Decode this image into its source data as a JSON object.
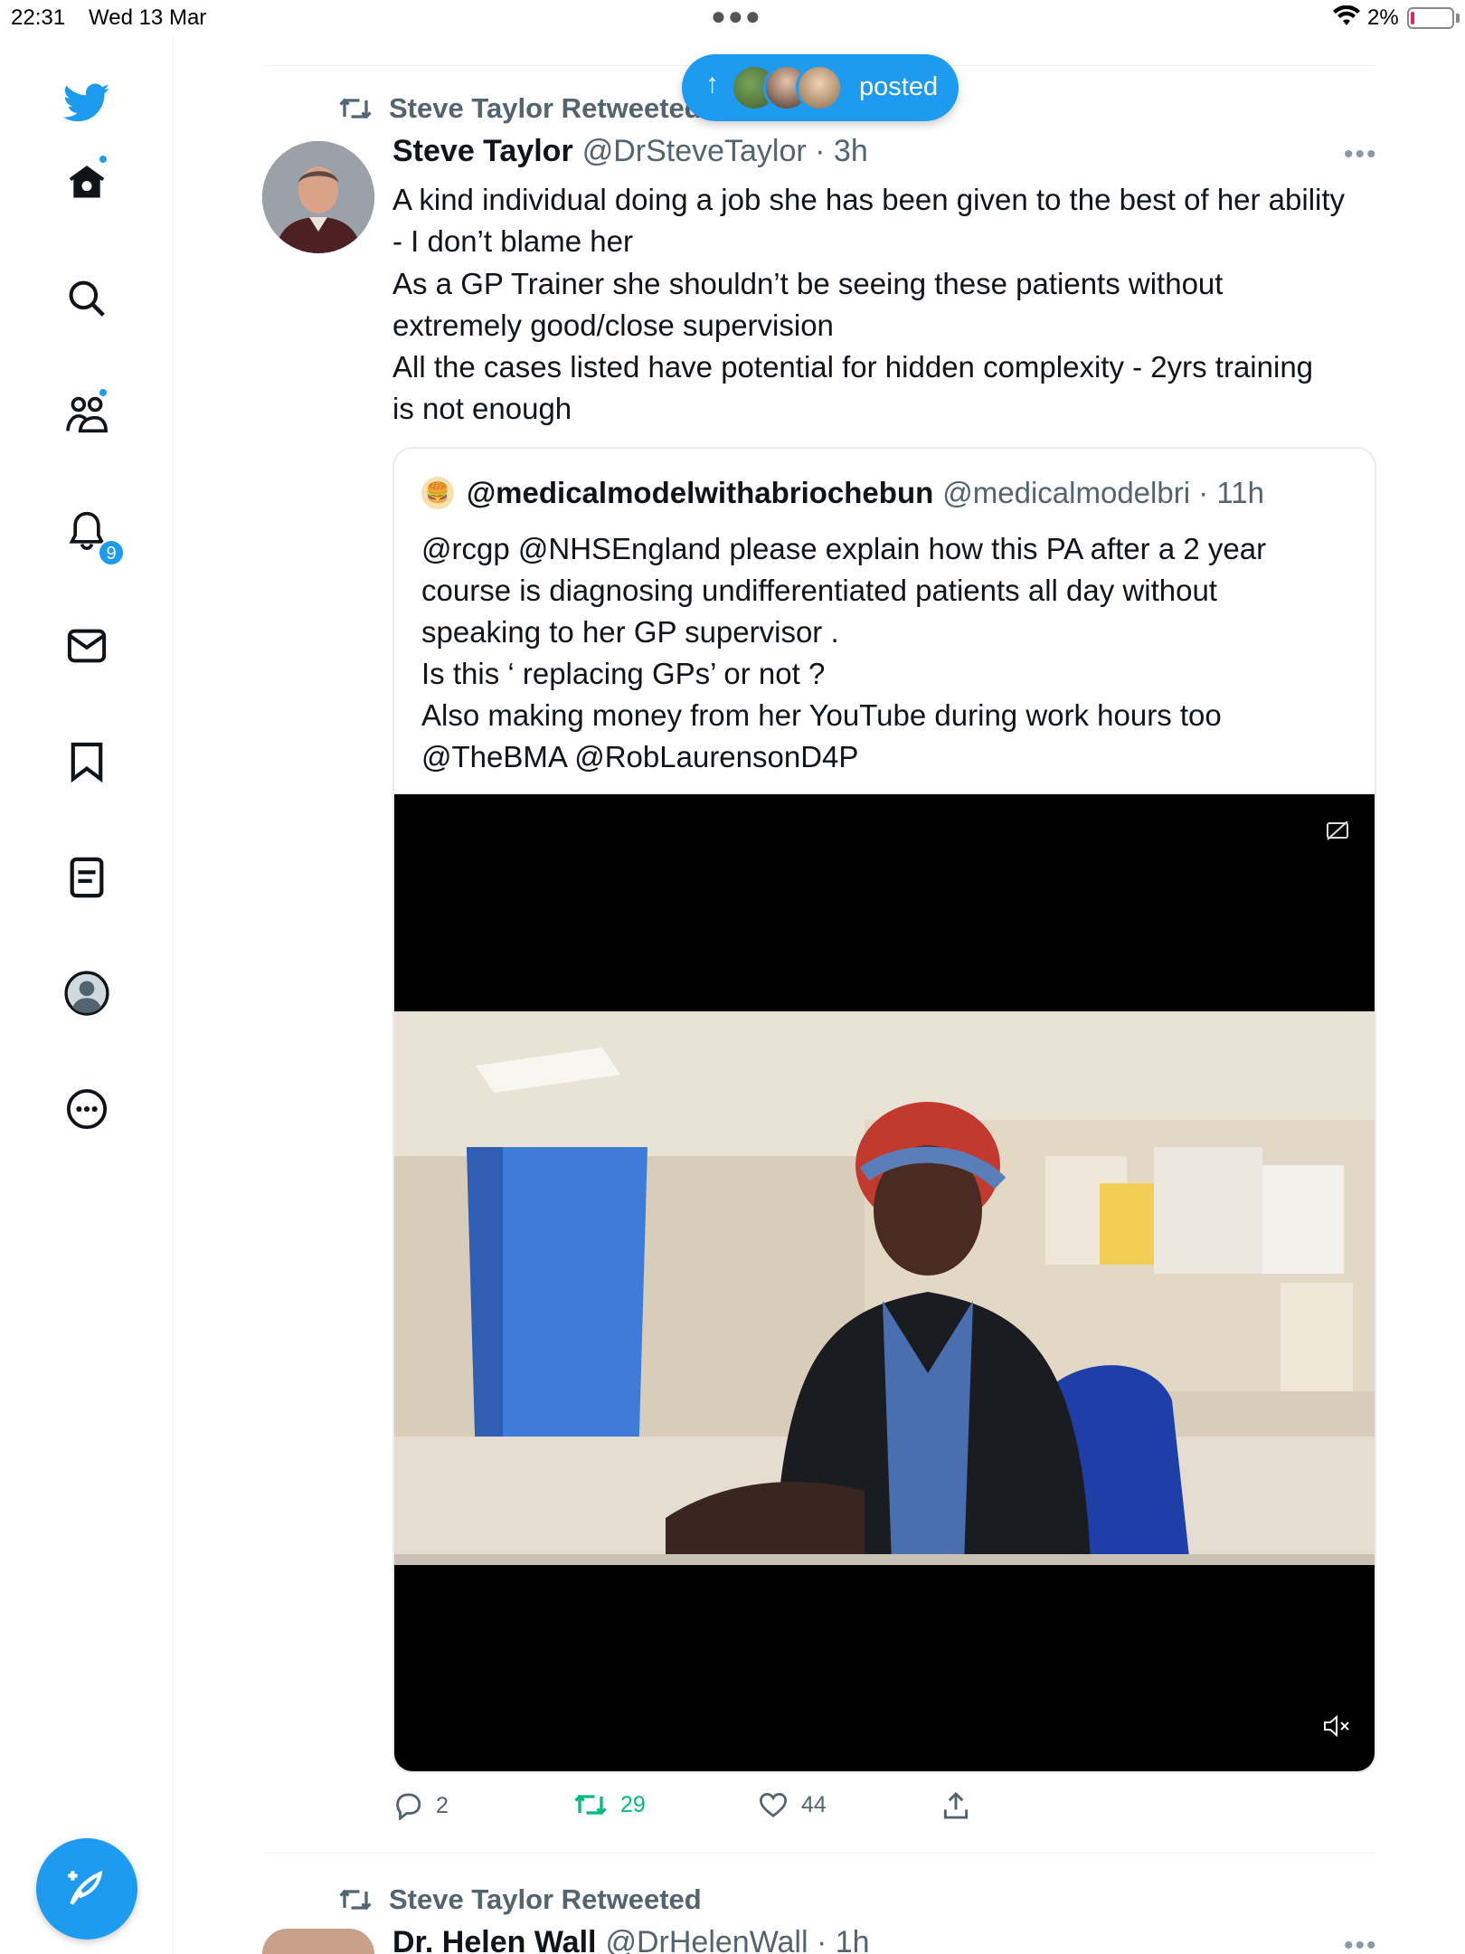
{
  "status_bar": {
    "time": "22:31",
    "date": "Wed 13 Mar",
    "battery": "2%"
  },
  "nav": {
    "notifications_badge": "9",
    "accent_color": "#1d9bf0",
    "items": [
      "home-icon",
      "search-icon",
      "communities-icon",
      "notifications-icon",
      "messages-icon",
      "bookmarks-icon",
      "lists-icon",
      "profile-icon",
      "more-icon"
    ]
  },
  "new_posts_pill": {
    "label": "posted"
  },
  "tweet1": {
    "retweeted_by": "Steve Taylor Retweeted",
    "author_name": "Steve Taylor",
    "author_handle": "@DrSteveTaylor · 3h",
    "text_lines": [
      "A kind individual doing a job she has been given to the best of her ability",
      "- I don’t blame her",
      "As a GP Trainer she shouldn’t be seeing these patients without",
      "extremely good/close supervision",
      "All the cases listed have potential for hidden complexity - 2yrs training",
      "is not enough"
    ],
    "quote": {
      "name": "@medicalmodelwithabriochebun",
      "handle": "@medicalmodelbri · 11h",
      "text_lines": [
        "@rcgp @NHSEngland please explain how this PA after a 2 year",
        "course is diagnosing  undifferentiated patients all day without",
        "speaking to  her GP supervisor .",
        "Is  this ‘ replacing GPs’ or not ?",
        "Also making money from her YouTube during work hours too",
        "@TheBMA @RobLaurensonD4P"
      ]
    },
    "actions": {
      "replies": "2",
      "retweets": "29",
      "likes": "44"
    }
  },
  "tweet2": {
    "retweeted_by": "Steve Taylor Retweeted",
    "author_name": "Dr. Helen Wall",
    "author_handle": "@DrHelenWall · 1h"
  }
}
